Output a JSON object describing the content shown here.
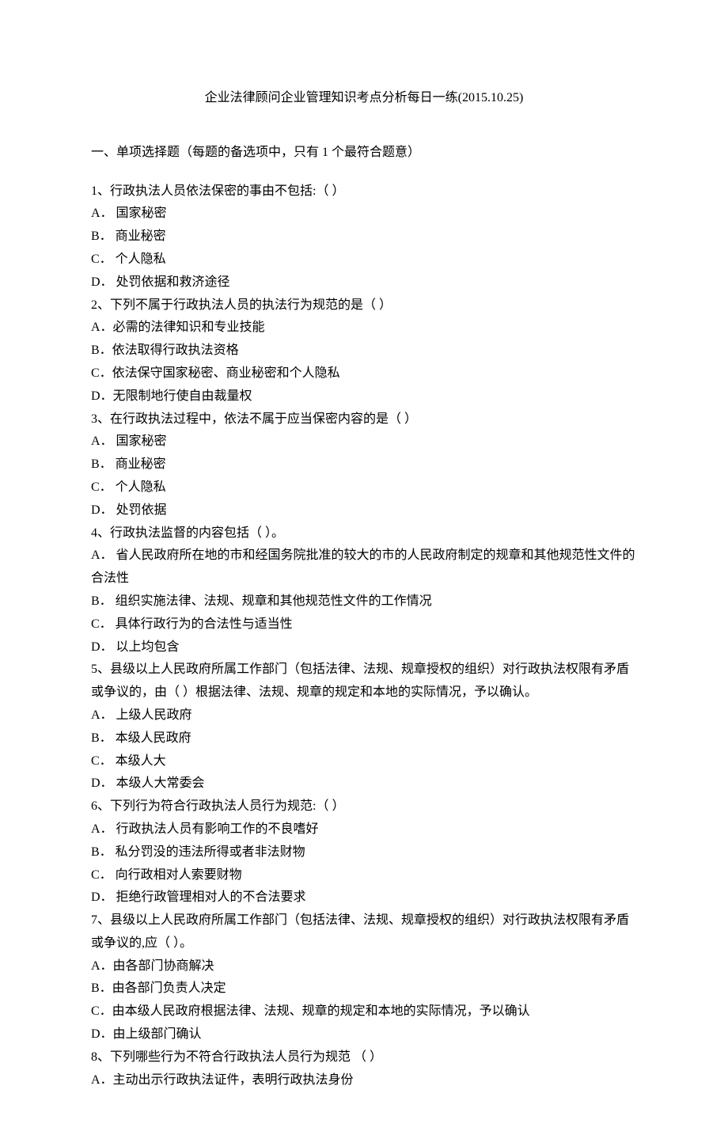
{
  "title": "企业法律顾问企业管理知识考点分析每日一练(2015.10.25)",
  "section": "一、单项选择题（每题的备选项中，只有 1 个最符合题意）",
  "questions": [
    {
      "stem": "1、行政执法人员依法保密的事由不包括:（ ）",
      "options": [
        "A．  国家秘密",
        "B．  商业秘密",
        "C．  个人隐私",
        "D．  处罚依据和救济途径"
      ]
    },
    {
      "stem": "2、下列不属于行政执法人员的执法行为规范的是（ ）",
      "options": [
        "A．必需的法律知识和专业技能",
        "B．依法取得行政执法资格",
        "C．依法保守国家秘密、商业秘密和个人隐私",
        "D．无限制地行使自由裁量权"
      ]
    },
    {
      "stem": "3、在行政执法过程中，依法不属于应当保密内容的是（ ）",
      "options": [
        "A．  国家秘密",
        "B．  商业秘密",
        "C．  个人隐私",
        "D．  处罚依据"
      ]
    },
    {
      "stem": "4、行政执法监督的内容包括（    ）。",
      "options": [
        "A．  省人民政府所在地的市和经国务院批准的较大的市的人民政府制定的规章和其他规范性文件的合法性",
        "B．  组织实施法律、法规、规章和其他规范性文件的工作情况",
        "C．  具体行政行为的合法性与适当性",
        "D．  以上均包含"
      ]
    },
    {
      "stem": "5、县级以上人民政府所属工作部门（包括法律、法规、规章授权的组织）对行政执法权限有矛盾或争议的，由（    ）根据法律、法规、规章的规定和本地的实际情况，予以确认。",
      "options": [
        "A．  上级人民政府",
        "B．  本级人民政府",
        "C．  本级人大",
        "D．  本级人大常委会"
      ]
    },
    {
      "stem": "6、下列行为符合行政执法人员行为规范:（ ）",
      "options": [
        "A．  行政执法人员有影响工作的不良嗜好",
        "B．  私分罚没的违法所得或者非法财物",
        "C．  向行政相对人索要财物",
        "D．  拒绝行政管理相对人的不合法要求"
      ]
    },
    {
      "stem": "7、县级以上人民政府所属工作部门（包括法律、法规、规章授权的组织）对行政执法权限有矛盾或争议的,应（    ）。",
      "options": [
        "A．由各部门协商解决",
        "B．由各部门负责人决定",
        "C．由本级人民政府根据法律、法规、规章的规定和本地的实际情况，予以确认",
        "D．由上级部门确认"
      ]
    },
    {
      "stem": "8、下列哪些行为不符合行政执法人员行为规范 （ ）",
      "options": [
        "A．主动出示行政执法证件，表明行政执法身份"
      ]
    }
  ]
}
